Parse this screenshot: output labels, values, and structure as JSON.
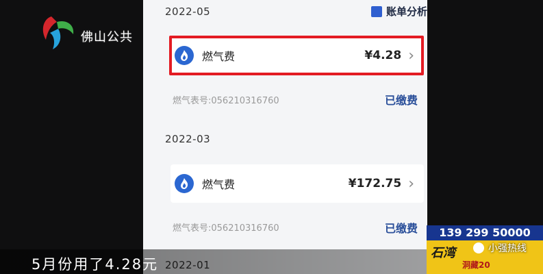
{
  "broadcast": {
    "channel_name": "佛山公共",
    "subtitle": "5月份用了4.28元",
    "hotline": "139 299 50000",
    "wechat_label": "小强热线",
    "promo_title": "石湾",
    "promo_sub": "洞藏20"
  },
  "app": {
    "bill_analysis_label": "账单分析",
    "sections": [
      {
        "month": "2022-05",
        "item_label": "燃气费",
        "amount": "¥4.28",
        "meter_text": "燃气表号:056210316760",
        "status": "已缴费"
      },
      {
        "month": "2022-03",
        "item_label": "燃气费",
        "amount": "¥172.75",
        "meter_text": "燃气表号:056210316760",
        "status": "已缴费"
      },
      {
        "month": "2022-01"
      }
    ]
  },
  "colors": {
    "highlight": "#e31b23",
    "accent": "#2b67d1",
    "status": "#2a4f9a",
    "hotline_bg": "#17358f",
    "promo_bg": "#f0c417"
  }
}
